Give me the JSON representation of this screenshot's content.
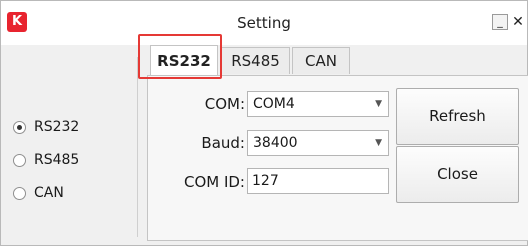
{
  "window": {
    "title": "Setting",
    "logo_glyph": "K",
    "minimize_glyph": "_",
    "close_glyph": "✕"
  },
  "interface_select": {
    "selected": "RS232",
    "options": [
      {
        "label": "RS232",
        "checked": true
      },
      {
        "label": "RS485",
        "checked": false
      },
      {
        "label": "CAN",
        "checked": false
      }
    ]
  },
  "tabs": [
    {
      "label": "RS232",
      "active": true
    },
    {
      "label": "RS485",
      "active": false
    },
    {
      "label": "CAN",
      "active": false
    }
  ],
  "form": {
    "com_label": "COM:",
    "com_value": "COM4",
    "baud_label": "Baud:",
    "baud_value": "38400",
    "com_id_label": "COM ID:",
    "com_id_value": "127"
  },
  "buttons": {
    "refresh_label": "Refresh",
    "close_label": "Close"
  },
  "colors": {
    "highlight": "#e53935",
    "logo": "#e8242f"
  }
}
